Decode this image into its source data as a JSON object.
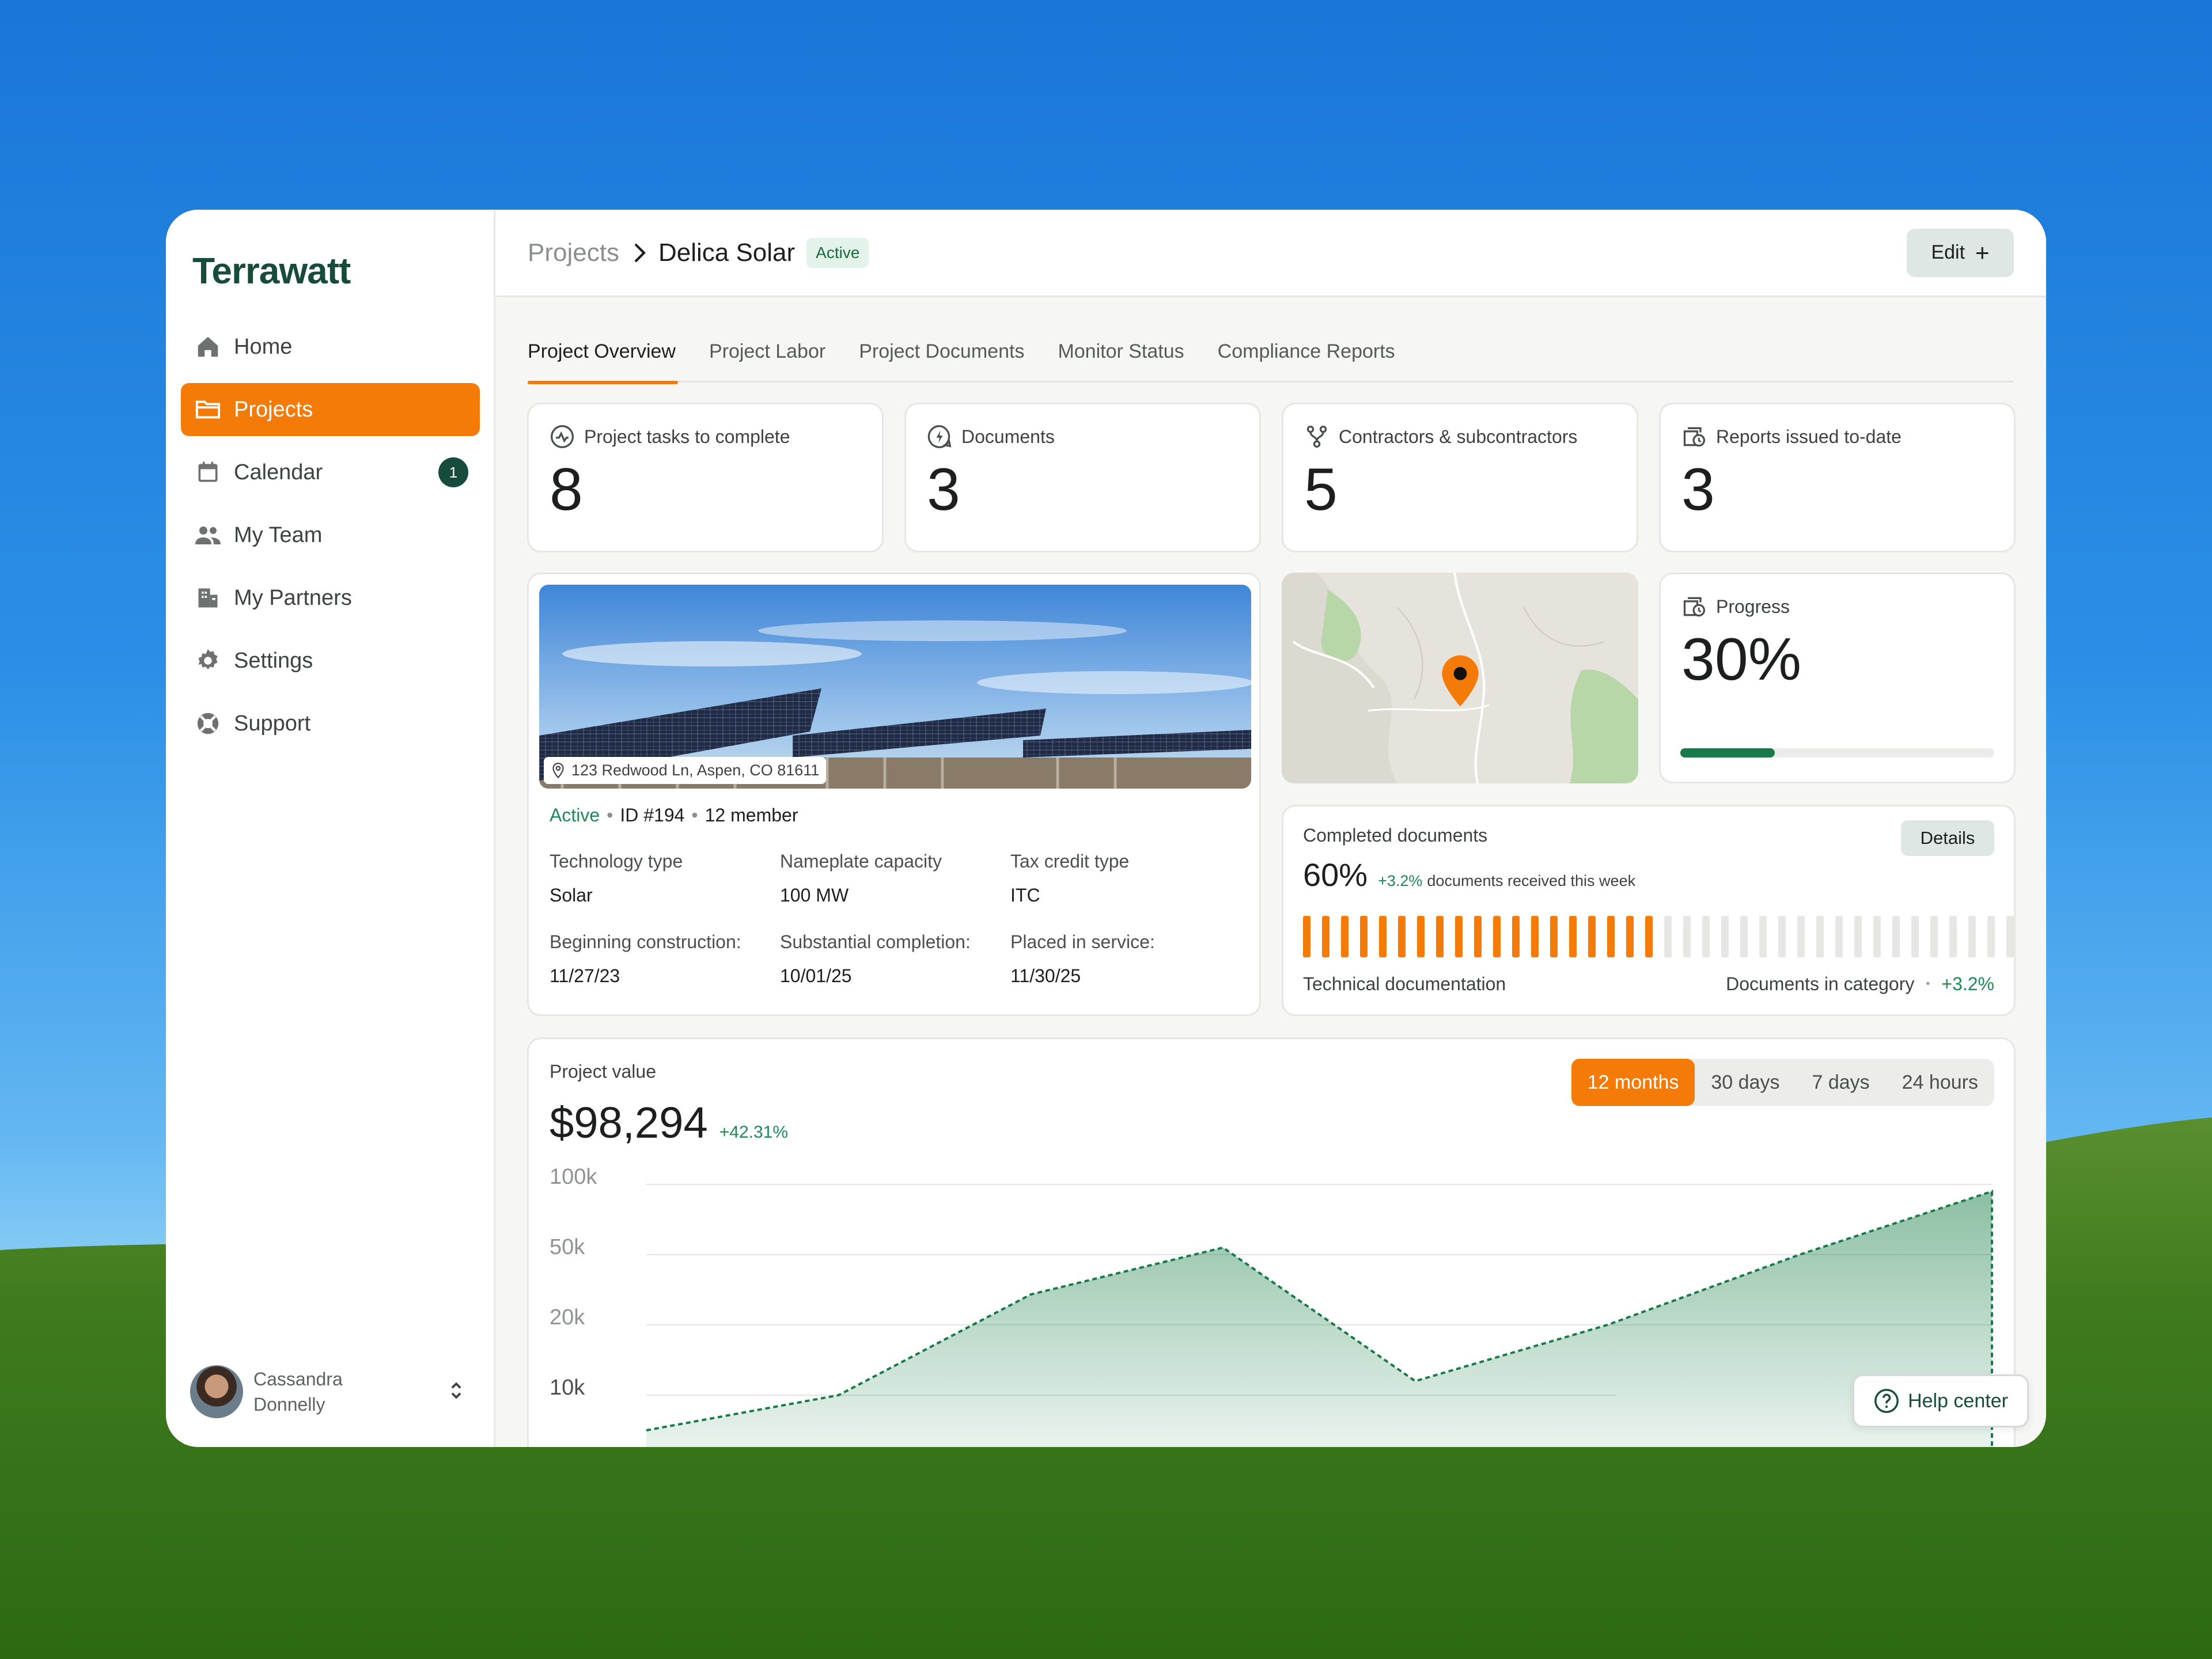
{
  "app": {
    "logo": "Terrawatt"
  },
  "sidebar": {
    "items": [
      {
        "label": "Home",
        "icon": "home-icon"
      },
      {
        "label": "Projects",
        "icon": "folder-icon",
        "active": true
      },
      {
        "label": "Calendar",
        "icon": "calendar-icon",
        "badge": "1"
      },
      {
        "label": "My Team",
        "icon": "team-icon"
      },
      {
        "label": "My Partners",
        "icon": "building-icon"
      },
      {
        "label": "Settings",
        "icon": "gear-icon"
      },
      {
        "label": "Support",
        "icon": "lifebuoy-icon"
      }
    ],
    "user": {
      "name": "Cassandra Donnelly"
    }
  },
  "header": {
    "breadcrumb_parent": "Projects",
    "breadcrumb_current": "Delica Solar",
    "status": "Active",
    "edit_label": "Edit"
  },
  "tabs": [
    "Project Overview",
    "Project Labor",
    "Project Documents",
    "Monitor Status",
    "Compliance Reports"
  ],
  "stats": [
    {
      "label": "Project tasks to complete",
      "value": "8",
      "icon": "activity-icon"
    },
    {
      "label": "Documents",
      "value": "3",
      "icon": "document-bolt-icon"
    },
    {
      "label": "Contractors & subcontractors",
      "value": "5",
      "icon": "branch-icon"
    },
    {
      "label": "Reports issued to-date",
      "value": "3",
      "icon": "report-clock-icon"
    }
  ],
  "project": {
    "address": "123 Redwood Ln, Aspen, CO 81611",
    "status": "Active",
    "id": "ID #194",
    "members": "12 member",
    "fields": [
      {
        "key": "Technology type",
        "value": "Solar"
      },
      {
        "key": "Nameplate capacity",
        "value": "100 MW"
      },
      {
        "key": "Tax credit type",
        "value": "ITC"
      },
      {
        "key": "Beginning construction:",
        "value": "11/27/23"
      },
      {
        "key": "Substantial completion:",
        "value": "10/01/25"
      },
      {
        "key": "Placed in service:",
        "value": "11/30/25"
      }
    ]
  },
  "progress": {
    "label": "Progress",
    "value_text": "30%",
    "fraction": 0.3,
    "icon": "report-clock-icon"
  },
  "completed_docs": {
    "title": "Completed documents",
    "percent": "60%",
    "delta": "+3.2%",
    "note": "documents received this week",
    "details_label": "Details",
    "category": "Technical documentation",
    "category_note": "Documents in category",
    "category_delta": "+3.2%",
    "bars_total": 38,
    "bars_filled": 19
  },
  "project_value": {
    "label": "Project value",
    "amount": "$98,294",
    "delta": "+42.31%",
    "ranges": [
      "12 months",
      "30 days",
      "7 days",
      "24 hours"
    ],
    "active_range": "12 months"
  },
  "chart_data": {
    "type": "area",
    "y_tick_labels": [
      "100k",
      "50k",
      "20k",
      "10k"
    ],
    "x": [
      0,
      1,
      2,
      3,
      4,
      5,
      6,
      7,
      8
    ],
    "values": [
      5000,
      10000,
      33000,
      55000,
      12000,
      20000,
      50000,
      95000,
      0
    ],
    "grid": true,
    "colors": {
      "line": "#187a48",
      "fill": "#2e8a58"
    }
  },
  "help": {
    "label": "Help center",
    "icon": "question-circle-icon"
  },
  "colors": {
    "accent": "#f47b08",
    "brand": "#174c3c",
    "positive": "#1f8a55"
  }
}
